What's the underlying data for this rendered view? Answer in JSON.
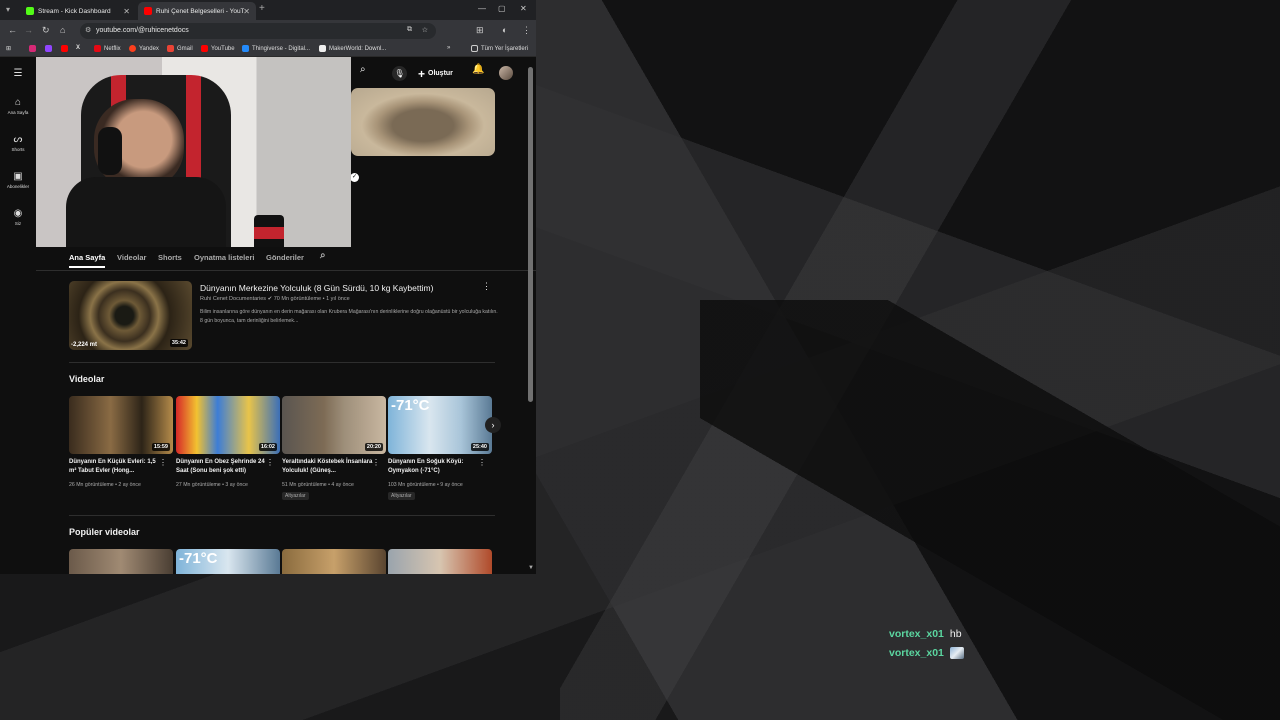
{
  "browser": {
    "tabs": [
      {
        "title": "Stream - Kick Dashboard",
        "favicon_color": "#53fc18"
      },
      {
        "title": "Ruhi Çenet Belgeselleri - YouTu",
        "favicon_color": "#ff0000"
      }
    ],
    "url": "youtube.com/@ruhicenetdocs",
    "bookmarks": [
      "Netflix",
      "Yandex",
      "Gmail",
      "YouTube",
      "Thingiverse - Digital...",
      "MakerWorld: Downl..."
    ],
    "all_bookmarks": "Tüm Yer İşaretleri"
  },
  "youtube": {
    "nav": [
      {
        "label": "Ana Sayfa"
      },
      {
        "label": "Shorts"
      },
      {
        "label": "Abonelikler"
      },
      {
        "label": "Siz"
      }
    ],
    "create_label": "Oluştur",
    "channel_tabs": [
      "Ana Sayfa",
      "Videolar",
      "Shorts",
      "Oynatma listeleri",
      "Gönderiler"
    ],
    "featured": {
      "title": "Dünyanın Merkezine Yolculuk (8 Gün Sürdü, 10 kg Kaybettim)",
      "channel": "Ruhi Cenet Documentaries",
      "views": "70 Mn görüntüleme",
      "age": "1 yıl önce",
      "description": "Bilim insanlarına göre dünyanın en derin mağarası olan Krubera Mağarası'nın derinliklerine doğru olağanüstü bir yolculuğa katılın. 8 gün boyunca, tam derinliğini belirlemek...",
      "duration": "35:42",
      "depth_label": "-2,224 mt"
    },
    "videos_heading": "Videolar",
    "videos": [
      {
        "title": "Dünyanın En Küçük Evleri: 1,5 m² Tabut Evler (Hong...",
        "meta": "26 Mn görüntüleme • 2 ay önce",
        "duration": "15:59",
        "badge": ""
      },
      {
        "title": "Dünyanın En Obez Şehrinde 24 Saat (Sonu beni şok etti)",
        "meta": "27 Mn görüntüleme • 3 ay önce",
        "duration": "16:02",
        "badge": ""
      },
      {
        "title": "Yeraltındaki Köstebek İnsanlara Yolculuk! (Güneş...",
        "meta": "51 Mn görüntüleme • 4 ay önce",
        "duration": "20:20",
        "badge": "Altyazılar"
      },
      {
        "title": "Dünyanın En Soğuk Köyü: Oymyakon (-71°C)",
        "meta": "103 Mn görüntüleme • 9 ay önce",
        "duration": "25:40",
        "badge": "Altyazılar"
      }
    ],
    "popular_heading": "Popüler videolar",
    "thumb_text_cold": "-71°C"
  },
  "chat": [
    {
      "user": "vortex_x01",
      "message": "hb",
      "emote": false
    },
    {
      "user": "vortex_x01",
      "message": "",
      "emote": true
    }
  ]
}
